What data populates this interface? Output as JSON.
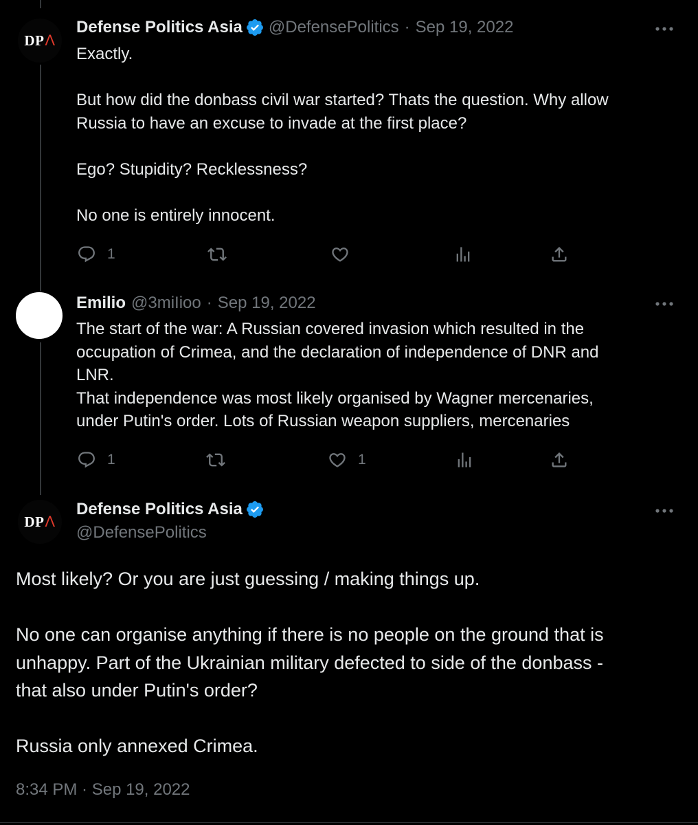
{
  "tweets": [
    {
      "author_name": "Defense Politics Asia",
      "author_handle": "@DefensePolitics",
      "separator": "·",
      "date": "Sep 19, 2022",
      "text": "Exactly.\n\nBut how did the donbass civil war started? Thats the question. Why allow\nRussia to have an excuse to invade at the first place?\n\nEgo? Stupidity? Recklessness?\n\nNo one is entirely innocent.",
      "replies": "1",
      "retweets": "",
      "likes": "",
      "views": ""
    },
    {
      "author_name": "Emilio",
      "author_handle": "@3miIioo",
      "separator": "·",
      "date": "Sep 19, 2022",
      "text": "The start of the war: A Russian covered invasion which resulted in the\noccupation of Crimea, and the declaration of independence of DNR and\nLNR.\nThat independence was most likely organised by Wagner mercenaries,\nunder Putin's order. Lots of Russian weapon suppliers, mercenaries",
      "replies": "1",
      "retweets": "",
      "likes": "1",
      "views": ""
    }
  ],
  "main_tweet": {
    "author_name": "Defense Politics Asia",
    "author_handle": "@DefensePolitics",
    "text": "Most likely?  Or you are just guessing / making things up.\n\nNo one can organise anything if there is no people on the ground that is\nunhappy. Part of the Ukrainian military defected to side of the donbass -\nthat also under Putin's order?\n\nRussia only annexed Crimea.",
    "timestamp": "8:34 PM · Sep 19, 2022"
  },
  "avatar_logo": {
    "letters_1": "D",
    "letters_2": "P",
    "letters_3": "Λ"
  },
  "icons": [
    "reply-icon",
    "retweet-icon",
    "like-icon",
    "views-icon",
    "share-icon",
    "more-icon",
    "verified-icon"
  ],
  "colors": {
    "background": "#000000",
    "text": "#e7e9ea",
    "muted": "#71767b",
    "verified": "#1d9bf0",
    "logo_accent": "#e0392b"
  }
}
